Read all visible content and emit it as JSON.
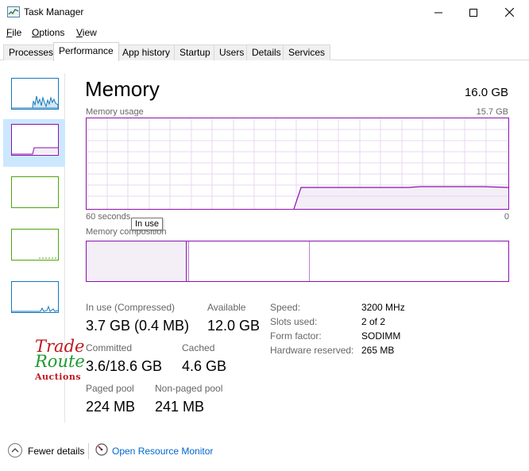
{
  "window": {
    "title": "Task Manager"
  },
  "menu": [
    {
      "accel": "F",
      "rest": "ile"
    },
    {
      "accel": "O",
      "rest": "ptions"
    },
    {
      "accel": "V",
      "rest": "iew"
    }
  ],
  "tabs": [
    "Processes",
    "Performance",
    "App history",
    "Startup",
    "Users",
    "Details",
    "Services"
  ],
  "active_tab": "Performance",
  "memory": {
    "title": "Memory",
    "total": "16.0 GB",
    "usage_label": "Memory usage",
    "usage_max": "15.7 GB",
    "time_left": "60 seconds",
    "time_right": "0",
    "composition_label": "Memory composition",
    "tooltip": "In use"
  },
  "stats": {
    "in_use_label": "In use (Compressed)",
    "in_use_value": "3.7 GB (0.4 MB)",
    "available_label": "Available",
    "available_value": "12.0 GB",
    "committed_label": "Committed",
    "committed_value": "3.6/18.6 GB",
    "cached_label": "Cached",
    "cached_value": "4.6 GB",
    "paged_label": "Paged pool",
    "paged_value": "224 MB",
    "nonpaged_label": "Non-paged pool",
    "nonpaged_value": "241 MB"
  },
  "specs": [
    {
      "label": "Speed:",
      "value": "3200 MHz"
    },
    {
      "label": "Slots used:",
      "value": "2 of 2"
    },
    {
      "label": "Form factor:",
      "value": "SODIMM"
    },
    {
      "label": "Hardware reserved:",
      "value": "265 MB"
    }
  ],
  "watermark": {
    "line1": "Trade",
    "line2": "Route",
    "line3": "Auctions"
  },
  "footer": {
    "fewer_details": "Fewer details",
    "open_resource_monitor": "Open Resource Monitor"
  },
  "colors": {
    "memory_accent": "#8b12ae",
    "memory_fill": "#f4eef7",
    "cpu_accent": "#1779ba",
    "disk_accent": "#4da60c",
    "selected_bg": "#cce8ff",
    "link": "#0066cc"
  },
  "icons": {
    "app": "task-manager-icon",
    "minimize": "minimize-icon",
    "maximize": "maximize-icon",
    "close": "close-icon",
    "fewer": "chevron-up-icon",
    "resmon": "resource-monitor-icon"
  }
}
